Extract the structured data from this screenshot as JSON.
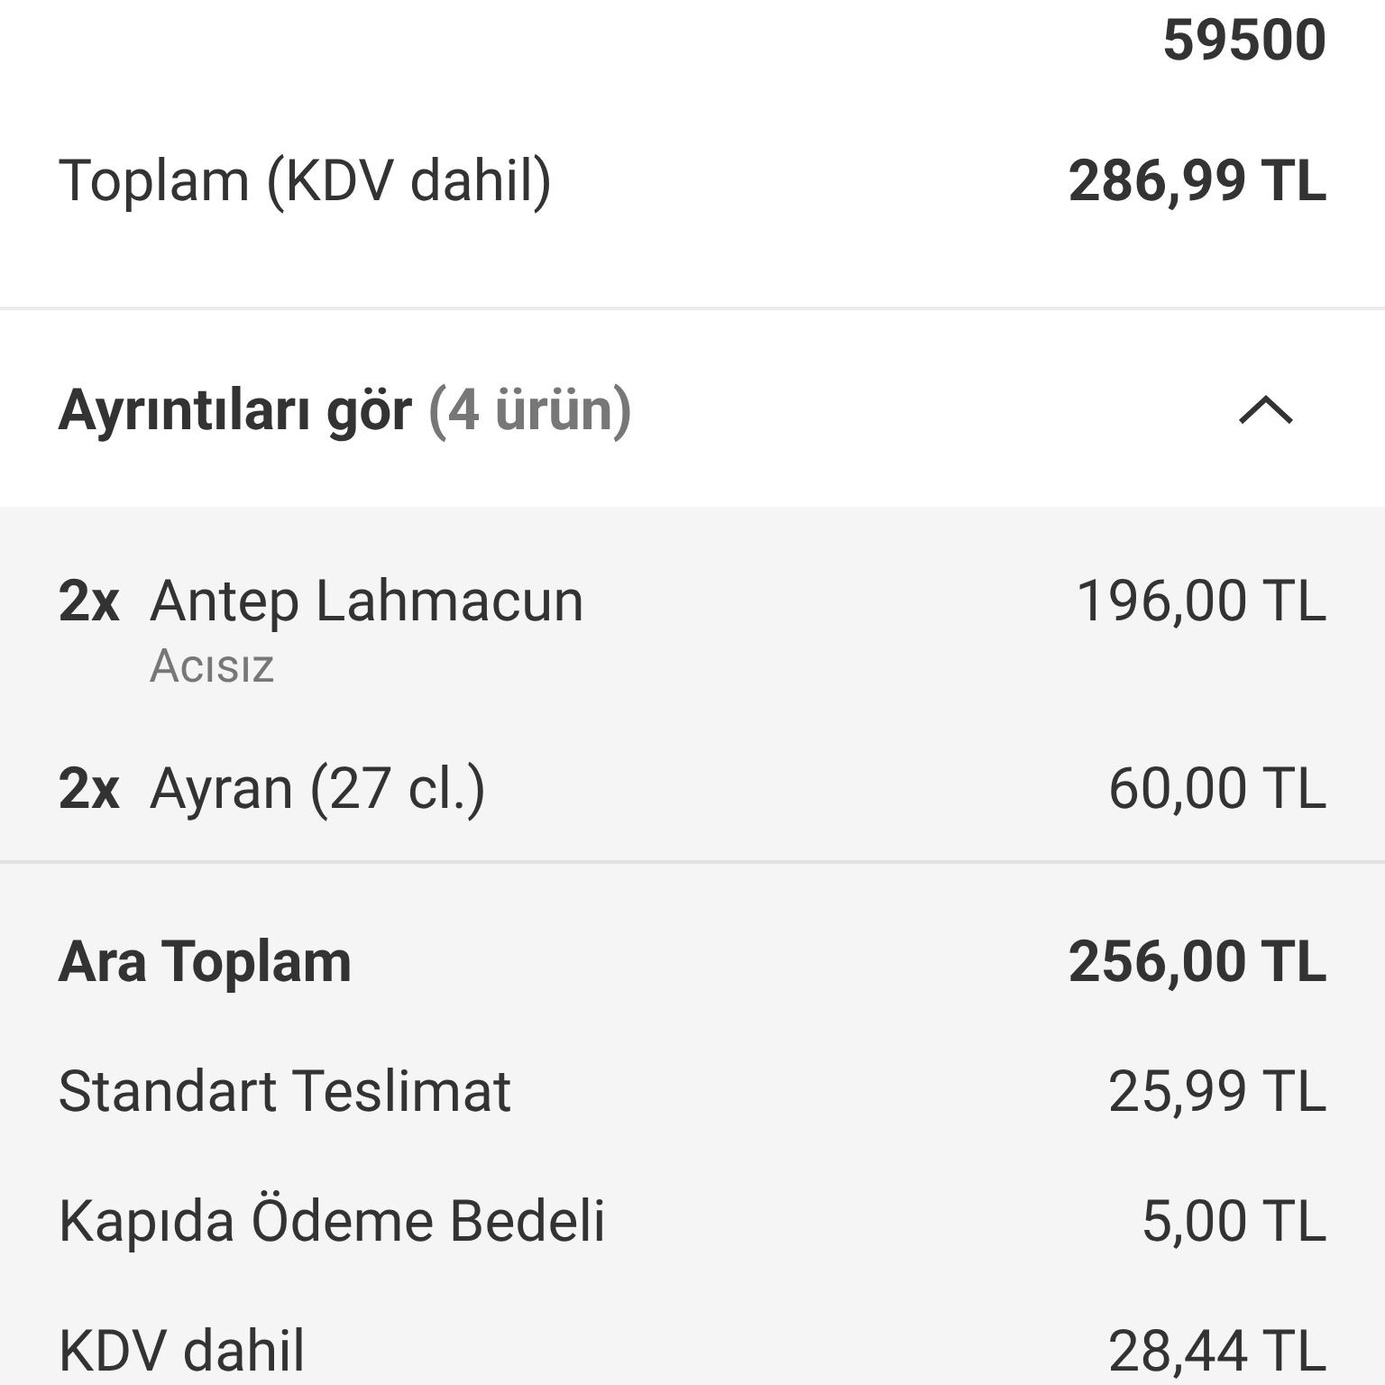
{
  "address_tail": "59500",
  "total": {
    "label": "Toplam (KDV dahil)",
    "value": "286,99 TL"
  },
  "details": {
    "title": "Ayrıntıları gör",
    "count": "(4 ürün)",
    "expanded": true
  },
  "items": [
    {
      "qty": "2x",
      "name": "Antep Lahmacun",
      "option": "Acısız",
      "price": "196,00 TL"
    },
    {
      "qty": "2x",
      "name": "Ayran (27 cl.)",
      "price": "60,00 TL"
    }
  ],
  "summary": [
    {
      "label": "Ara Toplam",
      "value": "256,00 TL",
      "bold": true
    },
    {
      "label": "Standart Teslimat",
      "value": "25,99 TL",
      "bold": false
    },
    {
      "label": "Kapıda Ödeme Bedeli",
      "value": "5,00 TL",
      "bold": false
    },
    {
      "label": "KDV dahil",
      "value": "28,44 TL",
      "bold": false
    }
  ]
}
